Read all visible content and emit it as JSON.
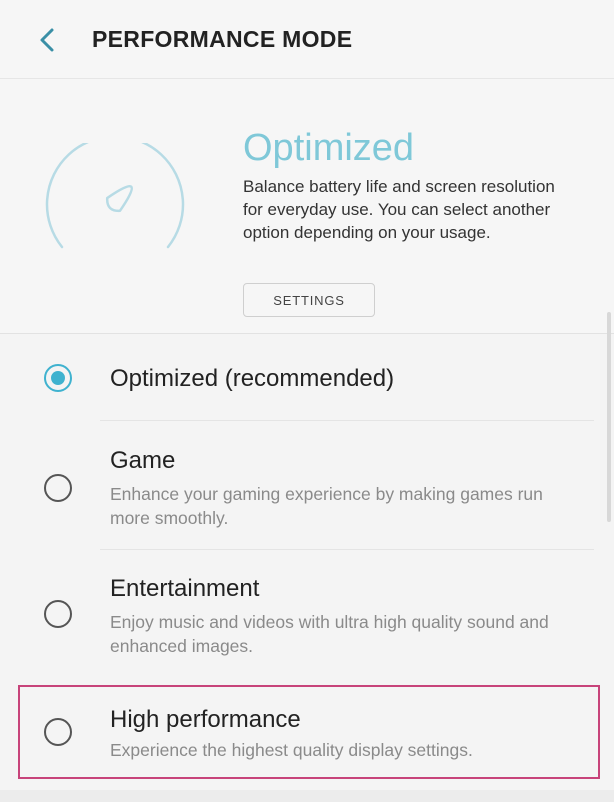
{
  "header": {
    "title": "PERFORMANCE MODE"
  },
  "hero": {
    "mode_title": "Optimized",
    "description": "Balance battery life and screen resolution for everyday use. You can select another option depending on your usage.",
    "settings_label": "SETTINGS"
  },
  "options": [
    {
      "title": "Optimized (recommended)",
      "description": "",
      "selected": true
    },
    {
      "title": "Game",
      "description": "Enhance your gaming experience by making games run more smoothly.",
      "selected": false
    },
    {
      "title": "Entertainment",
      "description": "Enjoy music and videos with ultra high quality sound and enhanced images.",
      "selected": false
    },
    {
      "title": "High performance",
      "description": "Experience the highest quality display settings.",
      "selected": false,
      "highlighted": true
    }
  ],
  "colors": {
    "accent": "#3fb2cf",
    "hero_title": "#7fc8d8",
    "highlight": "#c7437a"
  }
}
